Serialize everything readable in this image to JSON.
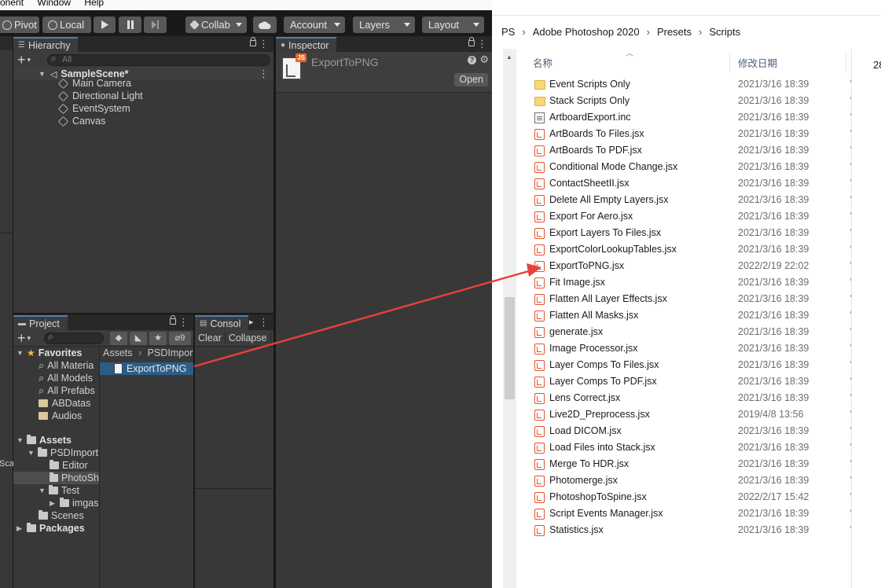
{
  "unity": {
    "menu": {
      "item1": "onent",
      "item2": "Window",
      "item3": "Help"
    },
    "toolbar": {
      "pivot": "Pivot",
      "local": "Local",
      "collab": "Collab",
      "account": "Account",
      "layers": "Layers",
      "layout": "Layout"
    },
    "hierarchy": {
      "tab": "Hierarchy",
      "search_placeholder": "All",
      "scene": "SampleScene*",
      "items": [
        "Main Camera",
        "Directional Light",
        "EventSystem",
        "Canvas"
      ]
    },
    "inspector": {
      "tab": "Inspector",
      "asset_name": "ExportToPNG",
      "open_label": "Open"
    },
    "project": {
      "tab": "Project",
      "hidden_count": "9",
      "breadcrumb": [
        "Assets",
        "PSDImport"
      ],
      "selected_asset": "ExportToPNG",
      "favorites": {
        "label": "Favorites",
        "items": [
          "All Materia",
          "All Models",
          "All Prefabs",
          "ABDatas",
          "Audios"
        ]
      },
      "assets": {
        "label": "Assets",
        "psdimport": "PSDImport",
        "editor": "Editor",
        "photosh": "PhotoSh",
        "test": "Test",
        "imgas": "imgas",
        "scenes": "Scenes"
      },
      "packages": "Packages"
    },
    "console": {
      "tab": "Consol",
      "clear": "Clear",
      "collapse": "Collapse"
    },
    "left_fragment": "Sca",
    "badge": "JS"
  },
  "explorer": {
    "breadcrumb": [
      "PS",
      "Adobe Photoshop 2020",
      "Presets",
      "Scripts"
    ],
    "col_name": "名称",
    "col_date": "修改日期",
    "right_fragment": "28",
    "files": [
      {
        "name": "Event Scripts Only",
        "date": "2021/3/16 18:39",
        "type": "folder"
      },
      {
        "name": "Stack Scripts Only",
        "date": "2021/3/16 18:39",
        "type": "folder"
      },
      {
        "name": "ArtboardExport.inc",
        "date": "2021/3/16 18:39",
        "type": "doc"
      },
      {
        "name": "ArtBoards To Files.jsx",
        "date": "2021/3/16 18:39",
        "type": "jsx"
      },
      {
        "name": "ArtBoards To PDF.jsx",
        "date": "2021/3/16 18:39",
        "type": "jsx"
      },
      {
        "name": "Conditional Mode Change.jsx",
        "date": "2021/3/16 18:39",
        "type": "jsx"
      },
      {
        "name": "ContactSheetII.jsx",
        "date": "2021/3/16 18:39",
        "type": "jsx"
      },
      {
        "name": "Delete All Empty Layers.jsx",
        "date": "2021/3/16 18:39",
        "type": "jsx"
      },
      {
        "name": "Export For Aero.jsx",
        "date": "2021/3/16 18:39",
        "type": "jsx"
      },
      {
        "name": "Export Layers To Files.jsx",
        "date": "2021/3/16 18:39",
        "type": "jsx"
      },
      {
        "name": "ExportColorLookupTables.jsx",
        "date": "2021/3/16 18:39",
        "type": "jsx"
      },
      {
        "name": "ExportToPNG.jsx",
        "date": "2022/2/19 22:02",
        "type": "jsx"
      },
      {
        "name": "Fit Image.jsx",
        "date": "2021/3/16 18:39",
        "type": "jsx"
      },
      {
        "name": "Flatten All Layer Effects.jsx",
        "date": "2021/3/16 18:39",
        "type": "jsx"
      },
      {
        "name": "Flatten All Masks.jsx",
        "date": "2021/3/16 18:39",
        "type": "jsx"
      },
      {
        "name": "generate.jsx",
        "date": "2021/3/16 18:39",
        "type": "jsx"
      },
      {
        "name": "Image Processor.jsx",
        "date": "2021/3/16 18:39",
        "type": "jsx"
      },
      {
        "name": "Layer Comps To Files.jsx",
        "date": "2021/3/16 18:39",
        "type": "jsx"
      },
      {
        "name": "Layer Comps To PDF.jsx",
        "date": "2021/3/16 18:39",
        "type": "jsx"
      },
      {
        "name": "Lens Correct.jsx",
        "date": "2021/3/16 18:39",
        "type": "jsx"
      },
      {
        "name": "Live2D_Preprocess.jsx",
        "date": "2019/4/8 13:56",
        "type": "jsx"
      },
      {
        "name": "Load DICOM.jsx",
        "date": "2021/3/16 18:39",
        "type": "jsx"
      },
      {
        "name": "Load Files into Stack.jsx",
        "date": "2021/3/16 18:39",
        "type": "jsx"
      },
      {
        "name": "Merge To HDR.jsx",
        "date": "2021/3/16 18:39",
        "type": "jsx"
      },
      {
        "name": "Photomerge.jsx",
        "date": "2021/3/16 18:39",
        "type": "jsx"
      },
      {
        "name": "PhotoshopToSpine.jsx",
        "date": "2022/2/17 15:42",
        "type": "jsx"
      },
      {
        "name": "Script Events Manager.jsx",
        "date": "2021/3/16 18:39",
        "type": "jsx"
      },
      {
        "name": "Statistics.jsx",
        "date": "2021/3/16 18:39",
        "type": "jsx"
      }
    ]
  },
  "colors": {
    "annotation_arrow": "#e8403c",
    "unity_bg": "#383838",
    "selection": "#2c5d87",
    "explorer_bg": "#ffffff"
  }
}
